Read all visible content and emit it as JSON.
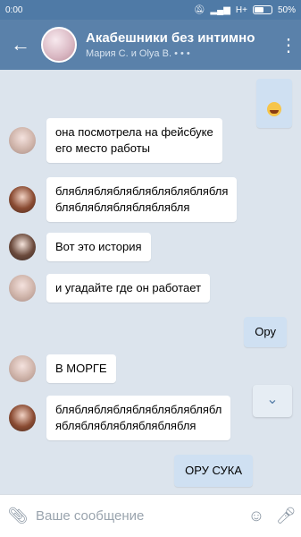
{
  "status_bar": {
    "time": "0:00",
    "network": "H+",
    "battery": "50%"
  },
  "header": {
    "back_icon": "arrow-left-icon",
    "title": "Акабешники без интимно",
    "subtitle": "Мария С. и Olya B.",
    "typing_dots": "• • •",
    "more_icon": "more-vertical-icon"
  },
  "messages": [
    {
      "direction": "out",
      "kind": "emoji",
      "text": ""
    },
    {
      "direction": "in",
      "avatar": "light",
      "text": "она посмотрела на фейсбуке\nего место работы"
    },
    {
      "direction": "in",
      "avatar": "dark",
      "text": "бляблябляблябляблябляблябля\nбляблябляблябляблябля"
    },
    {
      "direction": "in",
      "avatar": "mid",
      "text": "Вот это история"
    },
    {
      "direction": "in",
      "avatar": "light",
      "text": "и угадайте где он работает"
    },
    {
      "direction": "out",
      "text": "Ору"
    },
    {
      "direction": "in",
      "avatar": "light",
      "text": "В МОРГЕ"
    },
    {
      "direction": "in",
      "avatar": "dark",
      "text": "бляблябляблябляблябляблябл\nябляблябляблябляблябля"
    },
    {
      "direction": "out",
      "text": "ОРУ СУКА"
    }
  ],
  "input": {
    "placeholder": "Ваше сообщение"
  }
}
